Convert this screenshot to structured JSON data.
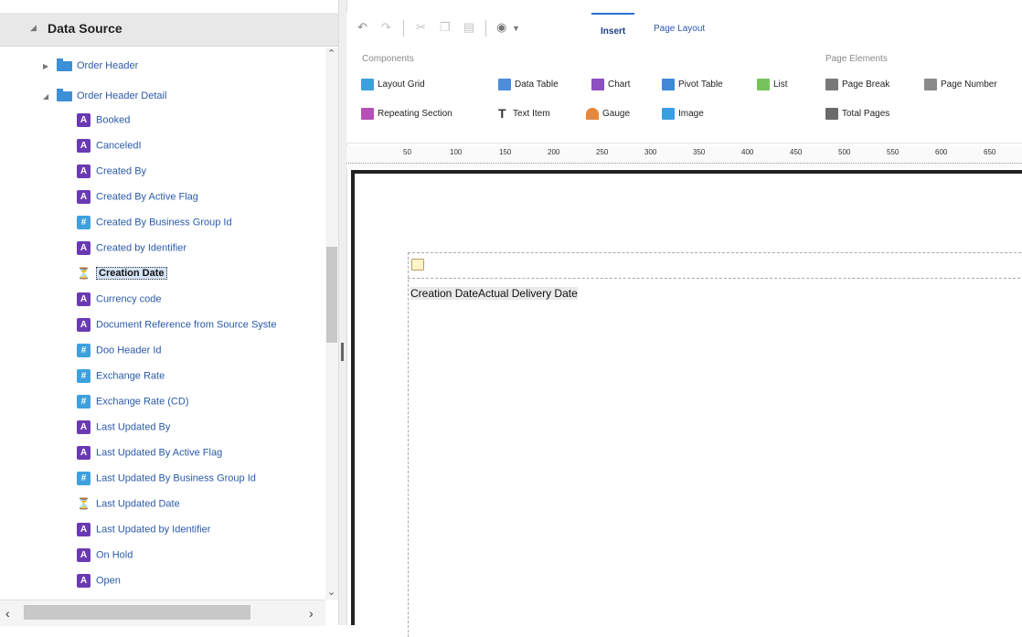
{
  "data_source": {
    "title": "Data Source",
    "folders": [
      {
        "label": "Order Header",
        "expanded": false
      },
      {
        "label": "Order Header Detail",
        "expanded": true
      }
    ],
    "fields": [
      {
        "label": "Booked",
        "type": "text"
      },
      {
        "label": "CanceledI",
        "type": "text"
      },
      {
        "label": "Created By",
        "type": "text"
      },
      {
        "label": "Created By Active Flag",
        "type": "text"
      },
      {
        "label": "Created By Business Group Id",
        "type": "number"
      },
      {
        "label": "Created by Identifier",
        "type": "text"
      },
      {
        "label": "Creation Date",
        "type": "date",
        "selected": true
      },
      {
        "label": "Currency code",
        "type": "text"
      },
      {
        "label": "Document Reference from Source Syste",
        "type": "text"
      },
      {
        "label": "Doo Header Id",
        "type": "number"
      },
      {
        "label": "Exchange Rate",
        "type": "number"
      },
      {
        "label": "Exchange Rate (CD)",
        "type": "number"
      },
      {
        "label": "Last Updated By",
        "type": "text"
      },
      {
        "label": "Last Updated By Active Flag",
        "type": "text"
      },
      {
        "label": "Last Updated By Business Group Id",
        "type": "number"
      },
      {
        "label": "Last Updated Date",
        "type": "date"
      },
      {
        "label": "Last Updated by Identifier",
        "type": "text"
      },
      {
        "label": "On Hold",
        "type": "text"
      },
      {
        "label": "Open",
        "type": "text"
      }
    ]
  },
  "toolbar": {
    "icons": [
      "undo-icon",
      "redo-icon",
      "cut-icon",
      "copy-icon",
      "paste-icon",
      "data-source-icon"
    ],
    "tabs": [
      {
        "label": "Insert",
        "active": true
      },
      {
        "label": "Page Layout",
        "active": false
      }
    ]
  },
  "ribbon": {
    "components": {
      "title": "Components",
      "items": [
        {
          "label": "Layout Grid",
          "icon": "layout-grid-icon"
        },
        {
          "label": "Data Table",
          "icon": "data-table-icon"
        },
        {
          "label": "Chart",
          "icon": "chart-icon"
        },
        {
          "label": "Pivot Table",
          "icon": "pivot-table-icon"
        },
        {
          "label": "List",
          "icon": "list-icon"
        },
        {
          "label": "Repeating Section",
          "icon": "repeating-section-icon"
        },
        {
          "label": "Text Item",
          "icon": "text-item-icon"
        },
        {
          "label": "Gauge",
          "icon": "gauge-icon"
        },
        {
          "label": "Image",
          "icon": "image-icon"
        }
      ]
    },
    "page_elements": {
      "title": "Page Elements",
      "items": [
        {
          "label": "Page Break",
          "icon": "page-break-icon"
        },
        {
          "label": "Page Number",
          "icon": "page-number-icon"
        },
        {
          "label": "Total Pages",
          "icon": "total-pages-icon"
        }
      ]
    }
  },
  "ruler": {
    "ticks": [
      "50",
      "100",
      "150",
      "200",
      "250",
      "300",
      "350",
      "400",
      "450",
      "500",
      "550",
      "600",
      "650"
    ]
  },
  "canvas": {
    "row_text": "Creation DateActual Delivery Date"
  }
}
